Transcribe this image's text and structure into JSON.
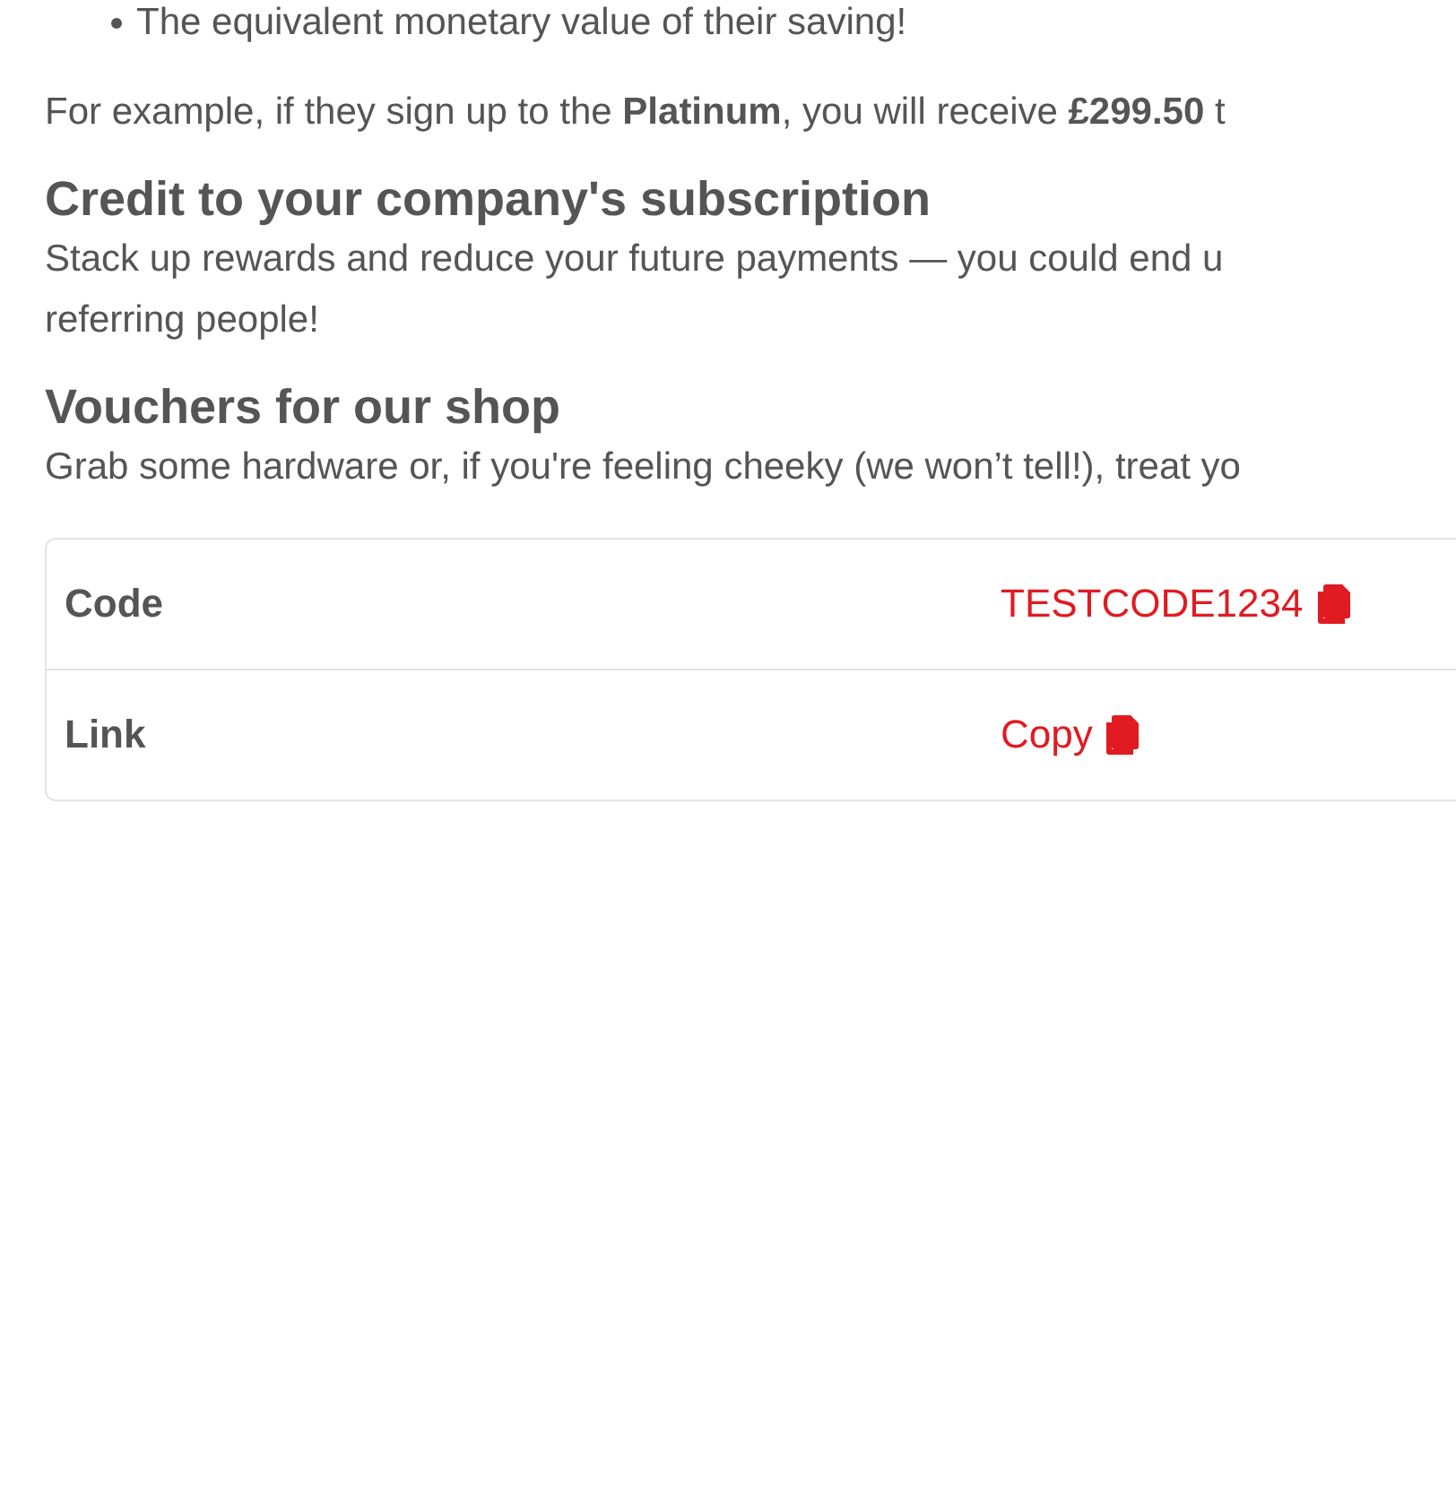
{
  "bullet": "The equivalent monetary value of their saving!",
  "example": "For example, if they sign up to the **Platinum**, you will receive **£299.50** t",
  "sections": [
    {
      "heading": "Credit to your company's subscription",
      "lines": [
        "Stack up rewards and reduce your future payments — you could end u",
        "referring people!"
      ]
    },
    {
      "heading": "Vouchers for our shop",
      "lines": [
        "Grab some hardware or, if you're feeling cheeky (we won’t tell!), treat yo"
      ]
    }
  ],
  "table": {
    "rows": [
      {
        "label": "Code",
        "value": "TESTCODE1234"
      },
      {
        "label": "Link",
        "value": "Copy"
      }
    ]
  }
}
